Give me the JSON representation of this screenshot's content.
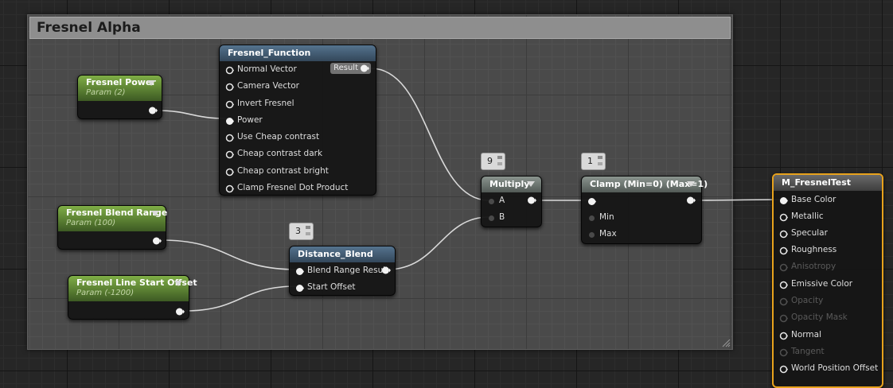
{
  "comment": {
    "title": "Fresnel Alpha"
  },
  "nodes": {
    "fresnel_function": {
      "title": "Fresnel_Function",
      "inputs": [
        "Normal Vector",
        "Camera Vector",
        "Invert Fresnel",
        "Power",
        "Use Cheap contrast",
        "Cheap contrast dark",
        "Cheap contrast bright",
        "Clamp Fresnel Dot Product"
      ],
      "output": "Result"
    },
    "fresnel_power": {
      "title": "Fresnel Power",
      "subtitle": "Param (2)"
    },
    "fresnel_blend_range": {
      "title": "Fresnel Blend Range",
      "subtitle": "Param (100)"
    },
    "fresnel_line_start": {
      "title": "Fresnel Line Start Offset",
      "subtitle": "Param (-1200)"
    },
    "distance_blend": {
      "title": "Distance_Blend",
      "counter": "3",
      "inputs": [
        "Blend Range Result",
        "Start Offset"
      ]
    },
    "multiply": {
      "title": "Multiply",
      "counter": "9",
      "inputs": [
        "A",
        "B"
      ]
    },
    "clamp": {
      "title": "Clamp (Min=0) (Max=1)",
      "counter": "1",
      "inputs": [
        "Min",
        "Max"
      ]
    },
    "material": {
      "title": "M_FresnelTest",
      "inputs": [
        {
          "label": "Base Color",
          "enabled": true
        },
        {
          "label": "Metallic",
          "enabled": true
        },
        {
          "label": "Specular",
          "enabled": true
        },
        {
          "label": "Roughness",
          "enabled": true
        },
        {
          "label": "Anisotropy",
          "enabled": false
        },
        {
          "label": "Emissive Color",
          "enabled": true
        },
        {
          "label": "Opacity",
          "enabled": false
        },
        {
          "label": "Opacity Mask",
          "enabled": false
        },
        {
          "label": "Normal",
          "enabled": true
        },
        {
          "label": "Tangent",
          "enabled": false
        },
        {
          "label": "World Position Offset",
          "enabled": true
        }
      ]
    }
  },
  "colors": {
    "wire": "#d9d9d9",
    "material_border": "#e8a21c",
    "function_header": "#44607a",
    "param_header": "#5f8b36",
    "math_header": "#6e7872"
  }
}
